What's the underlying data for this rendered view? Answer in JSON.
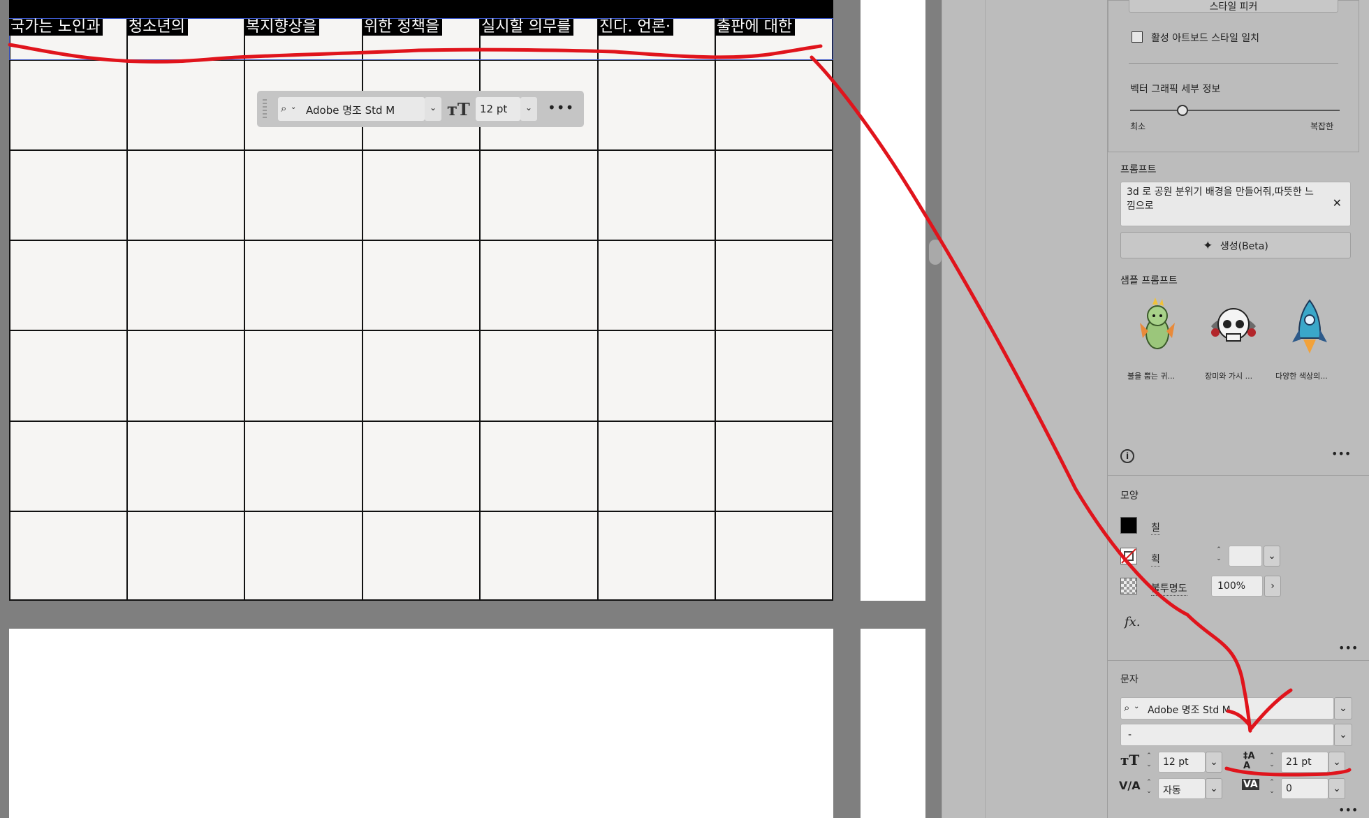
{
  "canvas": {
    "cell_texts": [
      "국가는 노인과",
      "청소년의",
      "복지향상을",
      "위한 정책을",
      "실시할 의무를",
      "진다. 언론·",
      "출판에 대한"
    ],
    "floating_toolbar": {
      "font_name": "Adobe 명조 Std M",
      "font_size": "12 pt",
      "more": "•••"
    }
  },
  "panel": {
    "top_button": "스타일 피커",
    "match_artboard_label": "활성 아트보드 스타일 일치",
    "vector_detail": {
      "title": "벡터 그래픽 세부 정보",
      "min_label": "최소",
      "max_label": "복잡한",
      "level": 0.25
    },
    "prompt": {
      "title": "프롬프트",
      "text": "3d 로 공원 분위기 배경을 만들어줘,따뜻한 느낌으로",
      "clear": "✕",
      "generate_button": "생성(Beta)"
    },
    "samples": {
      "title": "샘플 프롬프트",
      "items": [
        {
          "label": "불을 뿜는 귀...",
          "icon": "dragon-icon"
        },
        {
          "label": "장미와 가시 ...",
          "icon": "skull-icon"
        },
        {
          "label": "다양한 색상의...",
          "icon": "rocket-icon"
        }
      ],
      "more": "•••"
    },
    "appearance": {
      "title": "모양",
      "fill_label": "칠",
      "stroke_label": "획",
      "opacity_label": "불투명도",
      "opacity_value": "100%",
      "fx": "fx.",
      "more": "•••"
    },
    "character": {
      "title": "문자",
      "font_name": "Adobe 명조 Std M",
      "font_style": "-",
      "font_size": "12 pt",
      "leading": "21 pt",
      "kerning": "자동",
      "tracking": "0",
      "more": "•••"
    }
  },
  "colors": {
    "canvas_bg": "#7f7f7f",
    "panel_bg": "#bcbcbc",
    "artboard": "#f6f5f3",
    "annotation_red": "#e0141c",
    "selection_blue": "#3c57c9"
  }
}
